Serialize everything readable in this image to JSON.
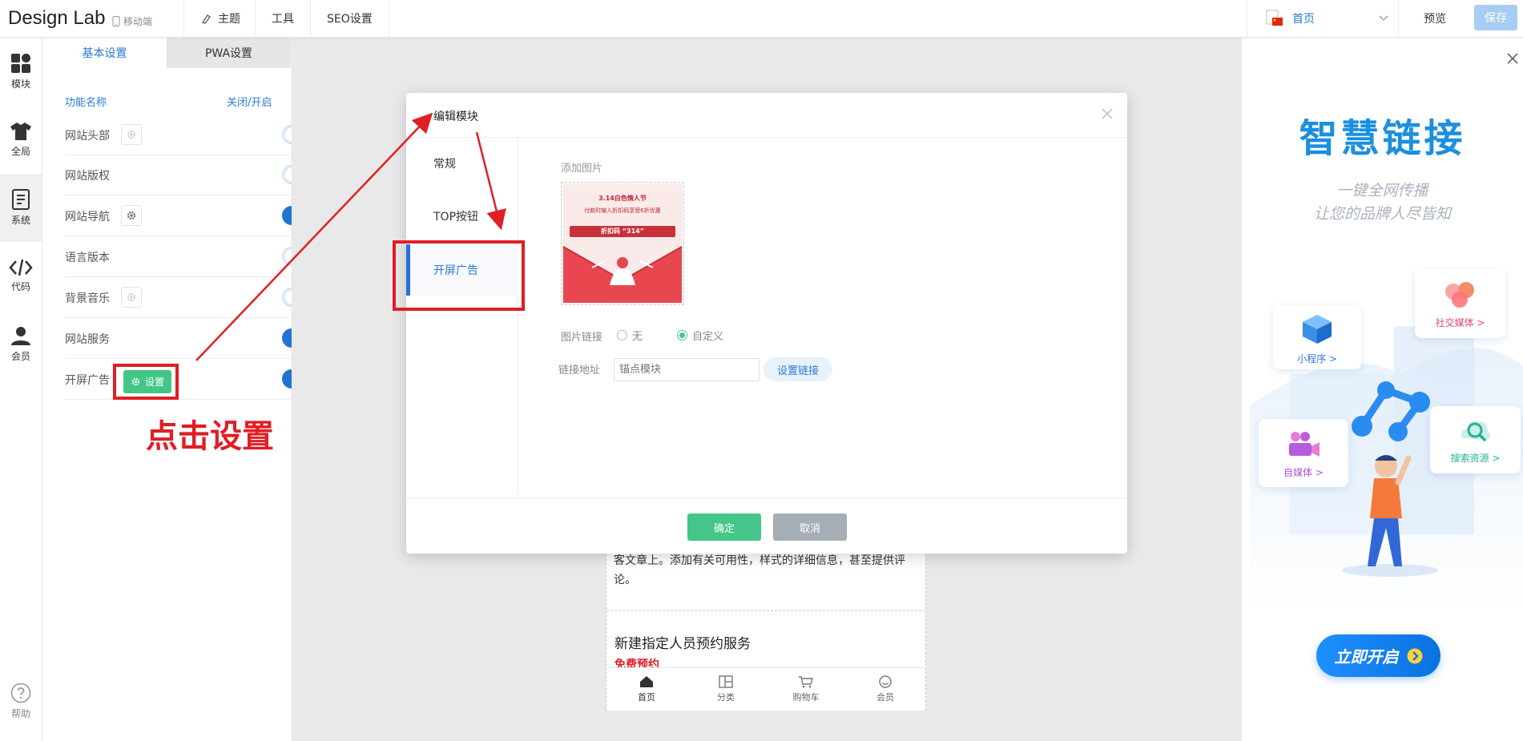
{
  "header": {
    "brand": "Design Lab",
    "mobile_hint": "移动端",
    "nav": [
      "主题",
      "工具",
      "SEO设置"
    ],
    "page_select": "首页",
    "preview": "预览",
    "save": "保存"
  },
  "rail": {
    "items": [
      {
        "label": "模块",
        "icon": "grid-icon"
      },
      {
        "label": "全局",
        "icon": "shirt-icon"
      },
      {
        "label": "系统",
        "icon": "document-icon"
      },
      {
        "label": "代码",
        "icon": "code-icon"
      },
      {
        "label": "会员",
        "icon": "user-icon"
      }
    ],
    "help": "帮助"
  },
  "panel": {
    "tabs": [
      "基本设置",
      "PWA设置"
    ],
    "header_name": "功能名称",
    "header_toggle": "关闭/开启",
    "rows": [
      {
        "label": "网站头部",
        "gear": true,
        "on": false
      },
      {
        "label": "网站版权",
        "gear": false,
        "on": false
      },
      {
        "label": "网站导航",
        "gear": true,
        "on": true
      },
      {
        "label": "语言版本",
        "gear": false,
        "on": false
      },
      {
        "label": "背景音乐",
        "gear": true,
        "on": false
      },
      {
        "label": "网站服务",
        "gear": false,
        "on": true
      },
      {
        "label": "开屏广告",
        "gear": false,
        "on": true
      }
    ],
    "settings_button": "设置"
  },
  "annotation": {
    "callout": "点击设置",
    "color": "#e01e26"
  },
  "modal": {
    "title": "编辑模块",
    "tabs": [
      "常规",
      "TOP按钮",
      "开屏广告"
    ],
    "add_image_label": "添加图片",
    "image": {
      "line1": "3.14白色情人节",
      "line2": "付款时输入折扣码享受6折优惠",
      "line3": "折扣码 “314”"
    },
    "link_label": "图片链接",
    "link_options": [
      "无",
      "自定义"
    ],
    "link_selected": "自定义",
    "url_label": "链接地址",
    "url_placeholder": "锚点模块",
    "set_link": "设置链接",
    "ok": "确定",
    "cancel": "取消"
  },
  "phone": {
    "text1": "客文章上。添加有关可用性，样式的详细信息，甚至提供评论。",
    "heading": "新建指定人员预约服务",
    "red_text": "免费预约",
    "nav": [
      "首页",
      "分类",
      "购物车",
      "会员"
    ]
  },
  "promo": {
    "title": "智慧链接",
    "sub1": "一键全网传播",
    "sub2": "让您的品牌人尽皆知",
    "cards": [
      "小程序 >",
      "社交媒体 >",
      "自媒体 >",
      "搜索资源 >"
    ],
    "cta": "立即开启"
  },
  "colors": {
    "accent": "#2174d4",
    "green": "#43c688",
    "annotation_red": "#e01e26"
  }
}
